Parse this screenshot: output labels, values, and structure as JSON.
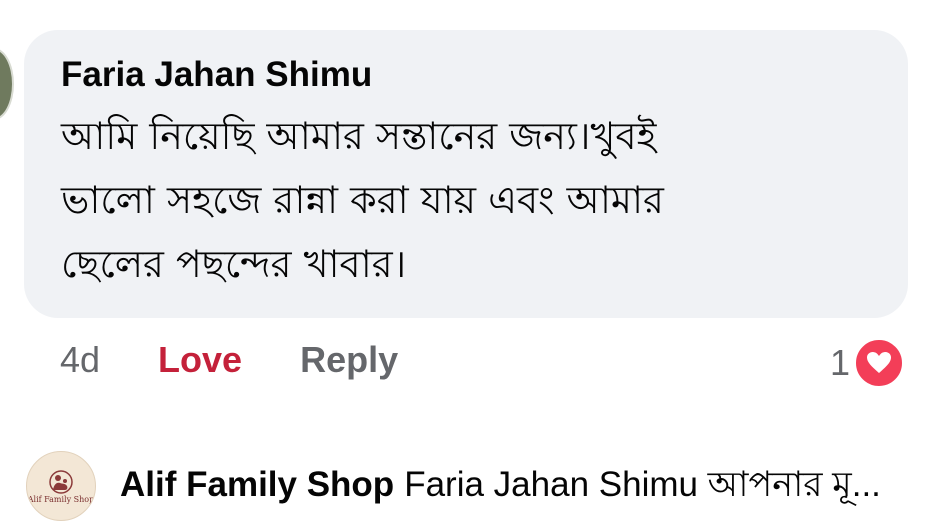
{
  "comment": {
    "author": "Faria Jahan Shimu",
    "text": "আমি নিয়েছি আমার সন্তানের জন্য।খুবই\nভালো সহজে রান্না করা যায় এবং আমার\nছেলের পছন্দের খাবার।",
    "time": "4d",
    "love_label": "Love",
    "reply_label": "Reply",
    "reaction_count": "1",
    "reaction_icon": "heart-icon",
    "colors": {
      "bubble": "#f0f2f5",
      "love": "#c4213a",
      "reaction_heart": "#f33e58",
      "muted": "#65676b"
    }
  },
  "reply": {
    "author": "Alif Family Shop",
    "snippet": "Faria Jahan Shimu আপনার মূ...",
    "avatar_text": "Alif Family Shop"
  }
}
